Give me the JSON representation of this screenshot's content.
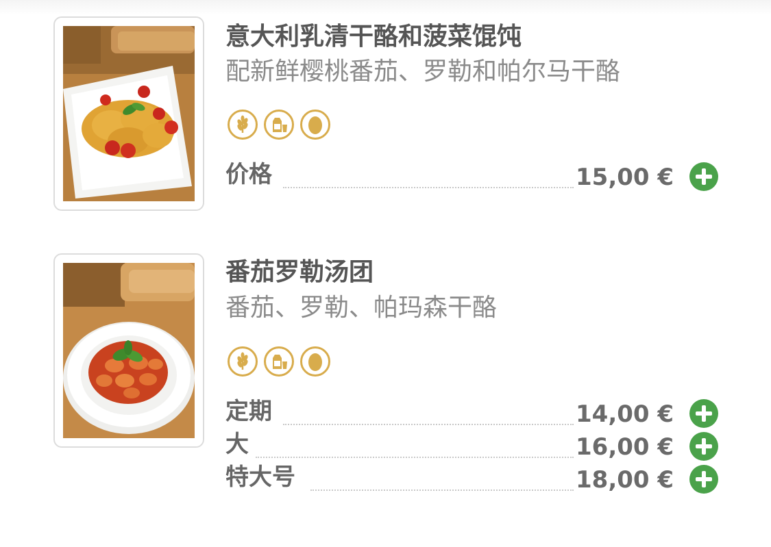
{
  "colors": {
    "allergen_gold": "#d8ac4c",
    "add_green": "#4aa24a",
    "title_gray": "#555555",
    "subtitle_gray": "#8a8a8a"
  },
  "items": [
    {
      "title": "意大利乳清干酪和菠菜馄饨",
      "subtitle": "配新鲜樱桃番茄、罗勒和帕尔马干酪",
      "allergens": [
        "wheat-icon",
        "milk-icon",
        "egg-icon"
      ],
      "image": "ravioli-dish-photo",
      "prices": [
        {
          "label": "价格",
          "value": "15,00 €"
        }
      ]
    },
    {
      "title": "番茄罗勒汤团",
      "subtitle": "番茄、罗勒、帕玛森干酪",
      "allergens": [
        "wheat-icon",
        "milk-icon",
        "egg-icon"
      ],
      "image": "gnocchi-dish-photo",
      "prices": [
        {
          "label": "定期",
          "value": "14,00 €"
        },
        {
          "label": "大",
          "value": "16,00 €"
        },
        {
          "label": "特大号",
          "value": "18,00 €"
        }
      ]
    }
  ]
}
